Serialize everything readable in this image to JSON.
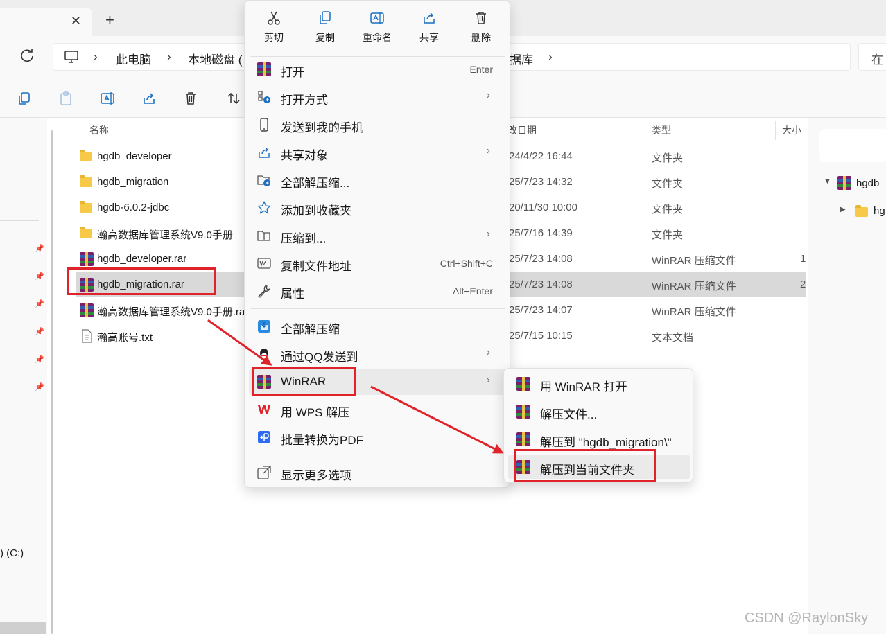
{
  "tab": {
    "close_glyph": "✕",
    "new_glyph": "+"
  },
  "address": {
    "crumbs": [
      "此电脑",
      "本地磁盘 (",
      "据库"
    ],
    "separator": "›",
    "search_placeholder": "在"
  },
  "columns": {
    "name": "名称",
    "date": "改日期",
    "type": "类型",
    "size": "大小"
  },
  "files": [
    {
      "icon": "folder-icon",
      "name": "hgdb_developer",
      "date": "24/4/22 16:44",
      "type": "文件夹",
      "size": ""
    },
    {
      "icon": "folder-icon",
      "name": "hgdb_migration",
      "date": "25/7/23 14:32",
      "type": "文件夹",
      "size": ""
    },
    {
      "icon": "folder-icon",
      "name": "hgdb-6.0.2-jdbc",
      "date": "20/11/30 10:00",
      "type": "文件夹",
      "size": ""
    },
    {
      "icon": "folder-icon",
      "name": "瀚高数据库管理系统V9.0手册",
      "date": "25/7/16 14:39",
      "type": "文件夹",
      "size": ""
    },
    {
      "icon": "winrar-icon",
      "name": "hgdb_developer.rar",
      "date": "25/7/23 14:08",
      "type": "WinRAR 压缩文件",
      "size": "1"
    },
    {
      "icon": "winrar-icon",
      "name": "hgdb_migration.rar",
      "date": "25/7/23 14:08",
      "type": "WinRAR 压缩文件",
      "size": "2",
      "selected": true
    },
    {
      "icon": "winrar-icon",
      "name": "瀚高数据库管理系统V9.0手册.ra",
      "date": "25/7/23 14:07",
      "type": "WinRAR 压缩文件",
      "size": ""
    },
    {
      "icon": "text-file-icon",
      "name": "瀚高账号.txt",
      "date": "25/7/15 10:15",
      "type": "文本文档",
      "size": ""
    }
  ],
  "navpane": {
    "drive_label": ") (C:)"
  },
  "rightpane": {
    "tree": [
      "hgdb_",
      "hg"
    ]
  },
  "context_menu": {
    "actions": [
      "剪切",
      "复制",
      "重命名",
      "共享",
      "删除"
    ],
    "items": [
      {
        "icon": "winrar-icon",
        "label": "打开",
        "shortcut": "Enter"
      },
      {
        "icon": "open-with-icon",
        "label": "打开方式",
        "submenu": true
      },
      {
        "icon": "phone-icon",
        "label": "发送到我的手机"
      },
      {
        "icon": "share-icon",
        "label": "共享对象",
        "submenu": true
      },
      {
        "icon": "extract-all-icon",
        "label": "全部解压缩..."
      },
      {
        "icon": "star-icon",
        "label": "添加到收藏夹"
      },
      {
        "icon": "compress-icon",
        "label": "压缩到...",
        "submenu": true
      },
      {
        "icon": "copy-path-icon",
        "label": "复制文件地址",
        "shortcut": "Ctrl+Shift+C"
      },
      {
        "icon": "wrench-icon",
        "label": "属性",
        "shortcut": "Alt+Enter"
      },
      {
        "icon": "extract-blue-icon",
        "label": "全部解压缩"
      },
      {
        "icon": "qq-icon",
        "label": "通过QQ发送到",
        "submenu": true
      },
      {
        "icon": "winrar-icon",
        "label": "WinRAR",
        "submenu": true,
        "hover": true
      },
      {
        "icon": "wps-icon",
        "label": "用 WPS 解压"
      },
      {
        "icon": "pdf-icon",
        "label": "批量转换为PDF"
      },
      {
        "icon": "more-options-icon",
        "label": "显示更多选项"
      }
    ],
    "arrow_glyph": "›"
  },
  "winrar_submenu": [
    {
      "icon": "winrar-icon",
      "label": "用 WinRAR 打开"
    },
    {
      "icon": "winrar-icon",
      "label": "解压文件..."
    },
    {
      "icon": "winrar-icon",
      "label": "解压到 \"hgdb_migration\\\""
    },
    {
      "icon": "winrar-icon",
      "label": "解压到当前文件夹",
      "hover": true
    }
  ],
  "annotation_color": "#e0232a",
  "watermark": "CSDN @RaylonSky"
}
